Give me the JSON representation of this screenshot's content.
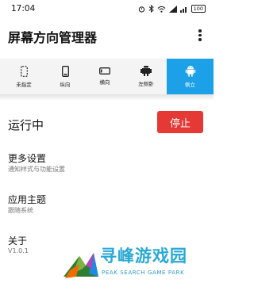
{
  "status_bar": {
    "time": "17:04",
    "battery": "100"
  },
  "app_bar": {
    "title": "屏幕方向管理器"
  },
  "orientation_tabs": [
    {
      "label": "未指定",
      "icon": "dashed-phone-icon"
    },
    {
      "label": "纵向",
      "icon": "portrait-phone-icon"
    },
    {
      "label": "横向",
      "icon": "landscape-phone-icon"
    },
    {
      "label": "左侧卧",
      "icon": "robot-side-icon"
    },
    {
      "label": "侧立",
      "icon": "android-icon",
      "active": true
    }
  ],
  "status": {
    "label": "运行中",
    "stop_label": "停止"
  },
  "settings": [
    {
      "title": "更多设置",
      "subtitle": "通知样式与功能设置"
    },
    {
      "title": "应用主题",
      "subtitle": "跟随系统"
    },
    {
      "title": "关于",
      "subtitle": "V1.0.1"
    }
  ],
  "watermark": {
    "text": "寻峰游戏园",
    "subtext": "PEAK SEARCH GAME PARK"
  },
  "colors": {
    "accent": "#1ca0e8",
    "stop": "#e53935"
  }
}
